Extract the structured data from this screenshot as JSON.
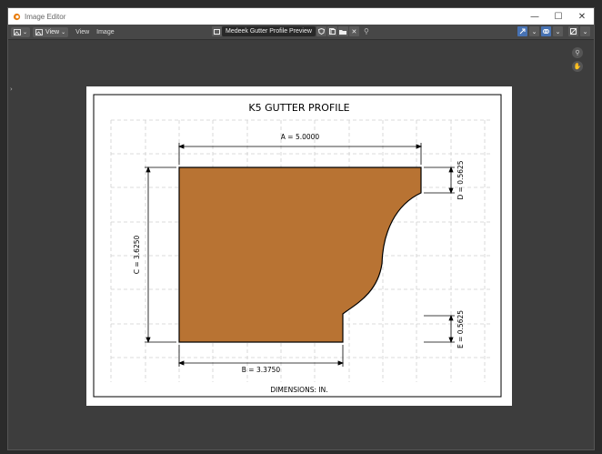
{
  "window": {
    "title": "Image Editor",
    "controls": [
      "—",
      "☐",
      "✕"
    ]
  },
  "header": {
    "view_label": "View",
    "menus": [
      "View",
      "Image"
    ],
    "image_name": "Medeek Gutter Profile Preview",
    "close_glyph": "✕"
  },
  "drawing": {
    "title": "K5 GUTTER PROFILE",
    "footer": "DIMENSIONS: IN.",
    "dims": {
      "a": "A = 5.0000",
      "b": "B = 3.3750",
      "c": "C = 3.6250",
      "d": "D = 0.5625",
      "e": "E = 0.5625"
    }
  },
  "colors": {
    "profile_fill": "#b87333",
    "grid": "#cfcfcf",
    "accent": "#4772b3"
  },
  "icons": {
    "pin": "pin-icon",
    "shield": "shield-icon",
    "new": "new-image-icon",
    "folder": "folder-icon"
  }
}
